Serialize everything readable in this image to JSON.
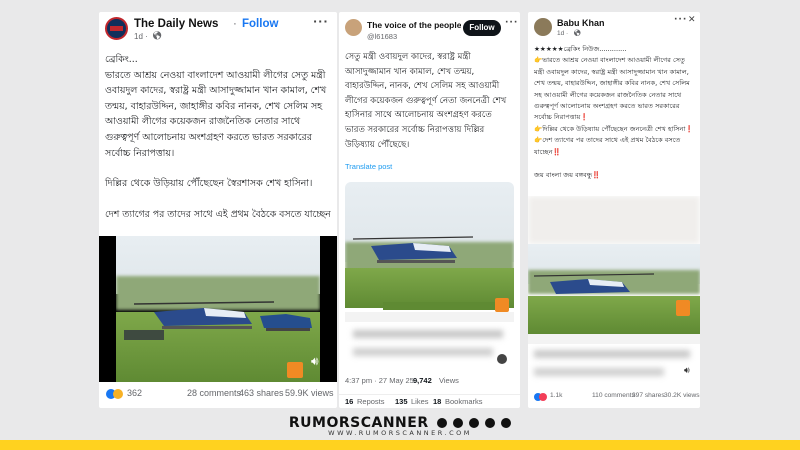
{
  "post1": {
    "page_name": "The Daily News",
    "follow_label": "Follow",
    "meta": "1d ·",
    "more_icon": "more-dots-icon",
    "text": [
      "ব্রেকিং...",
      "ভারতে আশ্রয় নেওয়া বাংলাদেশ আওয়ামী লীগের সেতু মন্ত্রী ওবায়দুল কাদের, স্বরাষ্ট্র মন্ত্রী আসাদুজ্জামান খান কামাল, শেখ তন্ময়, বাহারউদ্দিন, জাহাঙ্গীর কবির নানক, শেখ সেলিম সহ আওয়ামী লীগের কয়েকজন রাজনৈতিক নেতার সাথে গুরুত্বপূর্ণ আলোচনায় অংশগ্রহণ করতে ভারত সরকারের সর্বোচ্চ নিরাপত্তায়।",
      "দিল্লির থেকে উড়িয়ায় পৌঁছেছেন স্বৈরশাসক শেখ হাসিনা।",
      "দেশ ত্যাগের পর তাদের সাথে এই প্রথম বৈঠকে বসতে যাচ্ছেন"
    ],
    "reactions": "362",
    "comments": "28 comments",
    "shares": "463 shares",
    "views": "59.9K views"
  },
  "post2": {
    "page_name": "The voice of the people o...",
    "handle": "@l61683",
    "follow_label": "Follow",
    "text": "সেতু মন্ত্রী ওবায়দুল কাদের, স্বরাষ্ট্র মন্ত্রী আসাদুজ্জামান খান কামাল, শেখ তন্ময়, বাহারউদ্দিন, নানক, শেখ সেলিম সহ আওয়ামী লীগের কয়েকজন গুরুত্বপূর্ণ নেতা জননেত্রী শেখ হাসিনার সাথে আলোচনায় অংশগ্রহণ করতে ভারত সরকারের সর্বোচ্চ নিরাপত্তায় দিল্লির উড়িষ্যায় পৌঁছেছে।",
    "translate": "Translate post",
    "timestamp": "4:37 pm · 27 May 25 ·",
    "views_num": "9,742",
    "views_label": "Views",
    "reposts_num": "16",
    "reposts_label": "Reposts",
    "likes_num": "135",
    "likes_label": "Likes",
    "bookmarks_num": "18",
    "bookmarks_label": "Bookmarks"
  },
  "post3": {
    "page_name": "Babu Khan",
    "meta": "1d ·",
    "text": [
      "★★★★★ব্রেকিং নিউজ.............",
      "👉ভারতে আশ্রয় নেওয়া বাংলাদেশ আওয়ামী লীগের সেতু মন্ত্রী ওবায়দুল কাদের, স্বরাষ্ট্র মন্ত্রী আসাদুজ্জামান খান কামাল, শেখ তন্ময়, বাহারউদ্দিন, জাহাঙ্গীর কবির নানক, শেখ সেলিম সহ আওয়ামী লীগের কয়েকজন রাজনৈতিক নেতার সাথে গুরুত্বপূর্ণ আলোচনায় অংশগ্রহণ করতে ভারত সরকারের সর্বোচ্চ নিরাপত্তায়❗",
      "👉দিল্লির থেকে উড়িষ্যায় পৌঁছেছেন জননেত্রী শেখ হাসিনা❗",
      "👉দেশ ত্যাগের পর তাদের সাথে এই প্রথম বৈঠকে বসতে যাচ্ছেন‼️",
      "জয় বাংলা জয় বঙ্গবন্ধু‼️"
    ],
    "reactions": "1.1k",
    "comments": "110 comments",
    "shares": "397 shares",
    "views": "30.2K views"
  },
  "brand": {
    "name": "RUMORSCANNER",
    "url": "WWW.RUMORSCANNER.COM",
    "accent": "#ffd21f"
  }
}
